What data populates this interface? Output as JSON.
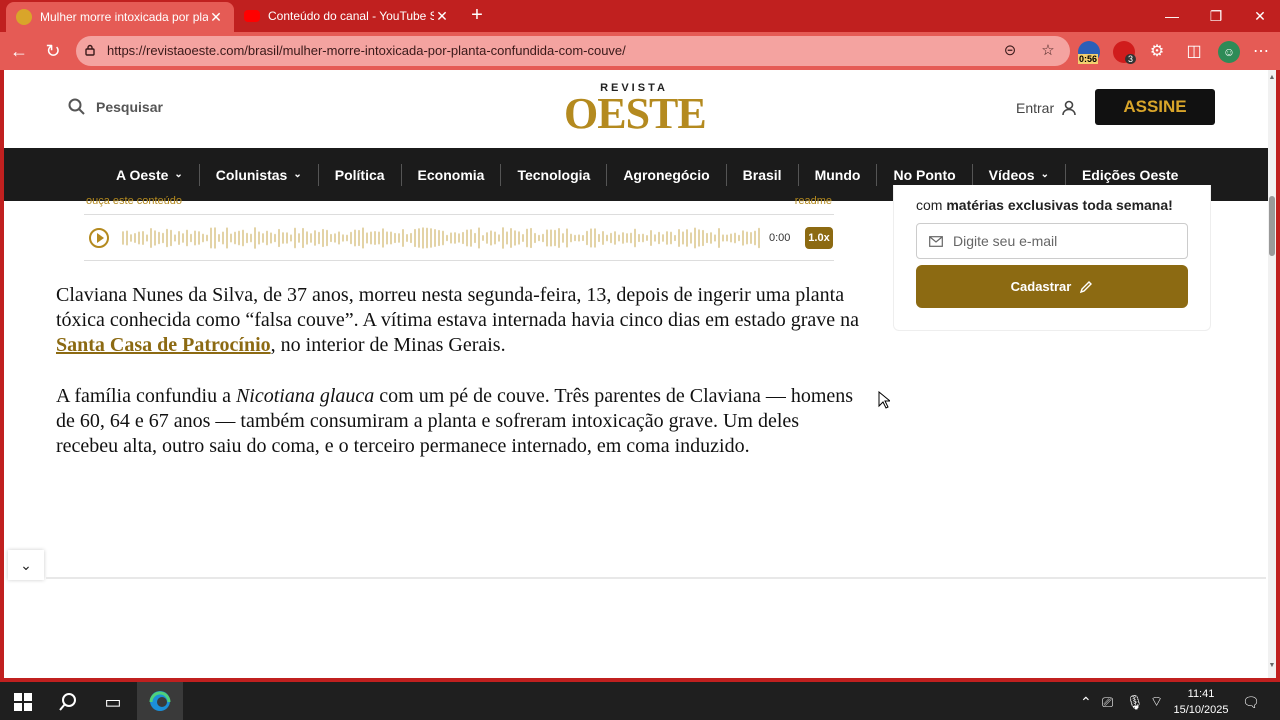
{
  "browser": {
    "tabs": [
      {
        "title": "Mulher morre intoxicada por planta",
        "active": true
      },
      {
        "title": "Conteúdo do canal - YouTube Studio",
        "active": false
      }
    ],
    "url": "https://revistaoeste.com/brasil/mulher-morre-intoxicada-por-planta-confundida-com-couve/",
    "extension_badges": {
      "timer": "0:56",
      "count": "3"
    }
  },
  "header": {
    "search_label": "Pesquisar",
    "logo_top": "REVISTA",
    "logo_main": "OESTE",
    "login_label": "Entrar",
    "subscribe_label": "ASSINE"
  },
  "menu": {
    "items": [
      {
        "label": "A Oeste",
        "dropdown": true
      },
      {
        "label": "Colunistas",
        "dropdown": true
      },
      {
        "label": "Política",
        "dropdown": false
      },
      {
        "label": "Economia",
        "dropdown": false
      },
      {
        "label": "Tecnologia",
        "dropdown": false
      },
      {
        "label": "Agronegócio",
        "dropdown": false
      },
      {
        "label": "Brasil",
        "dropdown": false
      },
      {
        "label": "Mundo",
        "dropdown": false
      },
      {
        "label": "No Ponto",
        "dropdown": false
      },
      {
        "label": "Vídeos",
        "dropdown": true
      },
      {
        "label": "Edições Oeste",
        "dropdown": false
      }
    ]
  },
  "audio": {
    "top_left": "ouça este conteúdo",
    "top_right": "readme",
    "time": "0:00",
    "speed": "1.0x"
  },
  "article": {
    "p1_before": "Claviana Nunes da Silva, de 37 anos, morreu nesta segunda-feira, 13, depois de ingerir uma planta tóxica conhecida como “falsa couve”. A vítima estava internada havia cinco dias em estado grave na ",
    "p1_link": "Santa Casa de Patrocínio",
    "p1_after": ", no interior de Minas Gerais.",
    "p2_before": "A família confundiu a ",
    "p2_italic": "Nicotiana glauca",
    "p2_after": " com um pé de couve. Três parentes de Claviana — homens de 60, 64 e 67 anos — também consumiram a planta e sofreram intoxicação grave. Um deles recebeu alta, outro saiu do coma, e o terceiro permanece internado, em coma induzido."
  },
  "newsletter": {
    "text_prefix": "com ",
    "text_bold": "matérias exclusivas toda semana!",
    "email_placeholder": "Digite seu e-mail",
    "button_label": "Cadastrar"
  },
  "taskbar": {
    "time": "11:41",
    "date": "15/10/2025"
  },
  "colors": {
    "browser_frame": "#c0201f",
    "brand_gold": "#b48a1f",
    "button_gold": "#8c6a12",
    "menu_bg": "#1b1b1b"
  }
}
